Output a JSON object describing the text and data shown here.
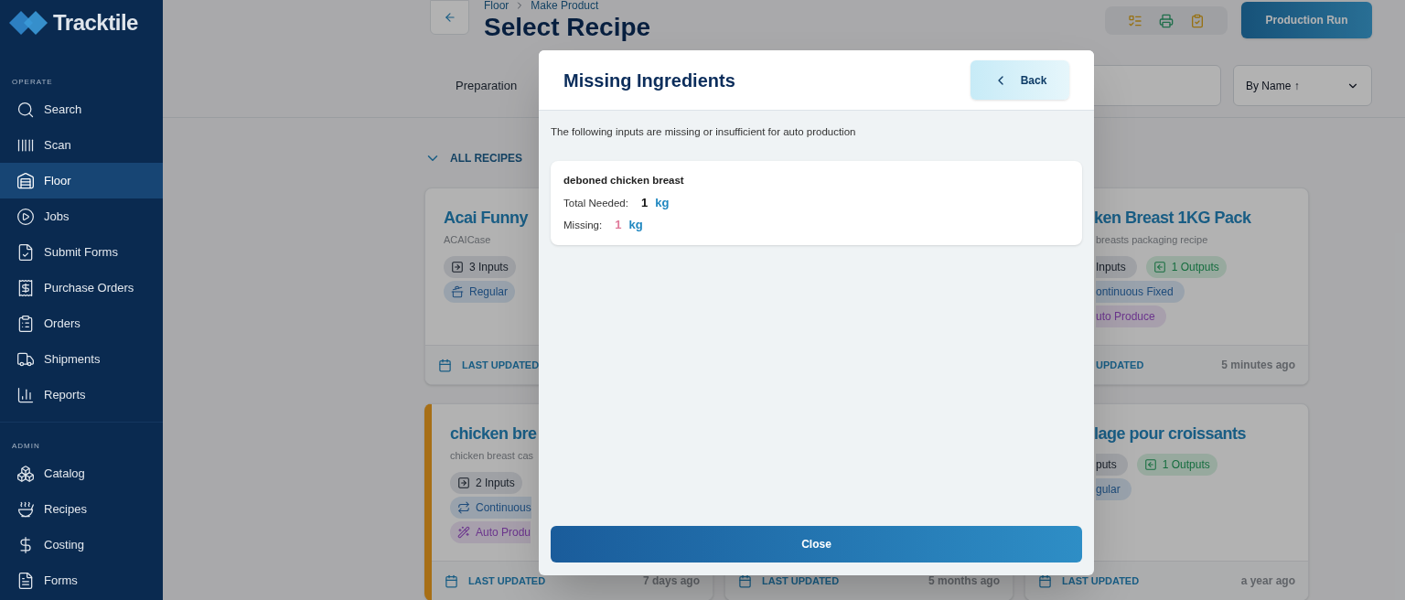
{
  "sidebar": {
    "logo": "Tracktile",
    "sections": [
      {
        "heading": "OPERATE",
        "items": [
          {
            "label": "Search",
            "selected": false
          },
          {
            "label": "Scan",
            "selected": false
          },
          {
            "label": "Floor",
            "selected": true
          },
          {
            "label": "Jobs",
            "selected": false
          },
          {
            "label": "Submit Forms",
            "selected": false
          },
          {
            "label": "Purchase Orders",
            "selected": false
          },
          {
            "label": "Orders",
            "selected": false
          },
          {
            "label": "Shipments",
            "selected": false
          },
          {
            "label": "Reports",
            "selected": false
          }
        ]
      },
      {
        "heading": "ADMIN",
        "items": [
          {
            "label": "Catalog",
            "selected": false
          },
          {
            "label": "Recipes",
            "selected": false
          },
          {
            "label": "Costing",
            "selected": false
          },
          {
            "label": "Forms",
            "selected": false
          }
        ]
      }
    ]
  },
  "header": {
    "breadcrumb": [
      "Floor",
      "Make Product"
    ],
    "title": "Select Recipe",
    "primary_button": "Production Run"
  },
  "filters": {
    "tab": "Preparation",
    "sort": "By Name ↑"
  },
  "group": {
    "label": "ALL RECIPES",
    "expanded": true
  },
  "recipes": [
    {
      "kind": "left",
      "flagged": false,
      "title": "Acai Funny",
      "subtitle": "ACAICase",
      "chips": [
        {
          "kind": "inputs",
          "label": "3 Inputs"
        },
        {
          "kind": "regular",
          "label": "Regular"
        }
      ],
      "footer": {
        "label": "LAST UPDATED",
        "cut": false
      }
    },
    {
      "kind": "covered"
    },
    {
      "kind": "right",
      "title": "ken Breast 1KG Pack",
      "subtitle": "breasts packaging recipe",
      "chips": [
        {
          "kind": "inputs",
          "label": "Inputs",
          "cut": true
        },
        {
          "kind": "outputs",
          "label": "1 Outputs",
          "cut": false
        },
        {
          "kind": "continuous",
          "label": "ontinuous Fixed",
          "cut": true
        },
        {
          "kind": "auto",
          "label": "uto Produce",
          "cut": true
        }
      ],
      "footer": {
        "label": "UPDATED",
        "time": "5 minutes ago",
        "cut": true
      }
    },
    {
      "kind": "left",
      "flagged": true,
      "title": "chicken bre",
      "subtitle": "chicken breast cas",
      "chips": [
        {
          "kind": "inputs",
          "label": "2 Inputs",
          "cut": false
        },
        {
          "kind": "continuous",
          "label": "Continuous",
          "cut": true
        },
        {
          "kind": "auto",
          "label": "Auto Produ",
          "cut": true
        }
      ],
      "footer": {
        "label": "LAST UPDATED",
        "time": "7 days ago",
        "cut": false
      }
    },
    {
      "kind": "covered",
      "footer": {
        "label": "LAST UPDATED",
        "time": "5 months ago",
        "cut": false
      }
    },
    {
      "kind": "right",
      "title": "lage pour croissants",
      "chips": [
        {
          "kind": "inputs",
          "label": "puts",
          "cut": true
        },
        {
          "kind": "outputs",
          "label": "1 Outputs",
          "cut": false
        },
        {
          "kind": "regular",
          "label": "gular",
          "cut": true
        }
      ],
      "footer": {
        "label": "LAST UPDATED",
        "time": "a year ago",
        "cut": false
      }
    }
  ],
  "dialog": {
    "title": "Missing Ingredients",
    "back_button": "Back",
    "message": "The following inputs are missing or insufficient for auto production",
    "items": [
      {
        "name": "deboned chicken breast",
        "total_label": "Total Needed:",
        "total_value": "1",
        "total_unit": "kg",
        "missing_label": "Missing:",
        "missing_value": "1",
        "missing_unit": "kg"
      }
    ],
    "close_button": "Close"
  }
}
